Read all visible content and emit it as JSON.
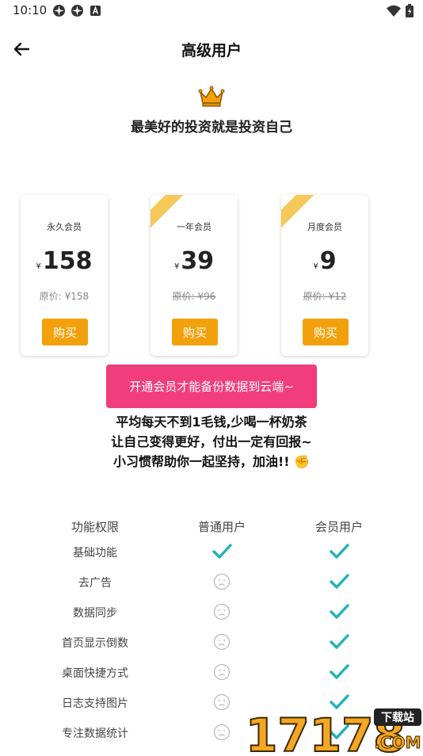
{
  "status_bar": {
    "time": "10:10"
  },
  "header": {
    "title": "高级用户"
  },
  "intro": {
    "slogan": "最美好的投资就是投资自己"
  },
  "plans": [
    {
      "name": "永久会员",
      "currency": "¥",
      "price": "158",
      "original": "原价: ¥158",
      "buy_label": "购买"
    },
    {
      "name": "一年会员",
      "currency": "¥",
      "price": "39",
      "original": "原价: ¥96",
      "buy_label": "购买"
    },
    {
      "name": "月度会员",
      "currency": "¥",
      "price": "9",
      "original": "原价: ¥12",
      "buy_label": "购买"
    }
  ],
  "backup_button": {
    "label": "开通会员才能备份数据到云端~"
  },
  "motto": {
    "line1": "平均每天不到1毛钱,少喝一杯奶茶",
    "line2": "让自己变得更好，付出一定有回报~",
    "line3": "小习惯帮助你一起坚持，加油!! ✊"
  },
  "comparison": {
    "headers": [
      "功能权限",
      "普通用户",
      "会员用户"
    ],
    "rows": [
      {
        "feature": "基础功能",
        "normal": true,
        "member": true
      },
      {
        "feature": "去广告",
        "normal": false,
        "member": true
      },
      {
        "feature": "数据同步",
        "normal": false,
        "member": true
      },
      {
        "feature": "首页显示倒数",
        "normal": false,
        "member": true
      },
      {
        "feature": "桌面快捷方式",
        "normal": false,
        "member": true
      },
      {
        "feature": "日志支持图片",
        "normal": false,
        "member": true
      },
      {
        "feature": "专注数据统计",
        "normal": false,
        "member": true
      }
    ]
  },
  "colors": {
    "accent_orange": "#f2a10c",
    "accent_pink": "#f13d7c",
    "check_teal": "#1fb3b9",
    "ribbon_gold": "#f5c85a"
  },
  "watermark": {
    "text": "17178",
    "sub_text": "下载站",
    "domain": ".COM"
  }
}
